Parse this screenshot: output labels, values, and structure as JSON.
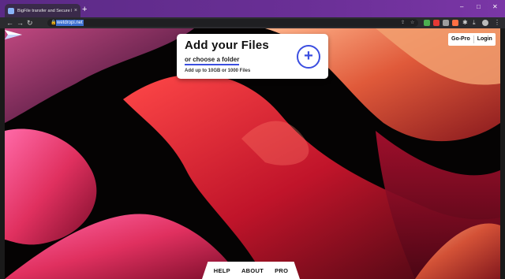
{
  "browser": {
    "tab_title": "BigFile transfer and Secure File S",
    "tab_close": "×",
    "new_tab": "+",
    "window_controls": {
      "minimize": "–",
      "maximize": "□",
      "close": "✕"
    },
    "url": "wetdropi.net",
    "accent_color": "#6a2f96"
  },
  "nav": {
    "back": "←",
    "forward": "→",
    "reload": "↻"
  },
  "upload": {
    "title": "Add your Files",
    "choose_folder": "or choose a folder",
    "limit": "Add up to 10GB or 1000 Files",
    "add_symbol": "+"
  },
  "account": {
    "go_pro": "Go-Pro",
    "login": "Login"
  },
  "footer": {
    "links": [
      "HELP",
      "ABOUT",
      "PRO"
    ]
  },
  "colors": {
    "brand_blue": "#3b4ee0"
  }
}
